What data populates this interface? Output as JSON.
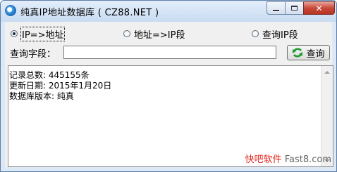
{
  "window": {
    "title": "纯真IP地址数据库 ( CZ88.NET )",
    "accent_color": "#c8493a",
    "controls": {
      "minimize_icon": "minimize-icon",
      "maximize_icon": "maximize-icon",
      "close_icon": "close-icon"
    }
  },
  "mode_options": [
    {
      "label": "IP=>地址",
      "selected": true
    },
    {
      "label": "地址=>IP段",
      "selected": false
    },
    {
      "label": "查询IP段",
      "selected": false
    }
  ],
  "query": {
    "label": "查询字段：",
    "value": "",
    "button_label": "查询",
    "button_icon": "refresh-icon"
  },
  "output": {
    "lines": [
      "记录总数: 445155条",
      "更新日期: 2015年1月20日",
      "数据库版本: 纯真"
    ]
  },
  "watermark": {
    "brand": "快吧软件",
    "site": "Fast8.com"
  }
}
